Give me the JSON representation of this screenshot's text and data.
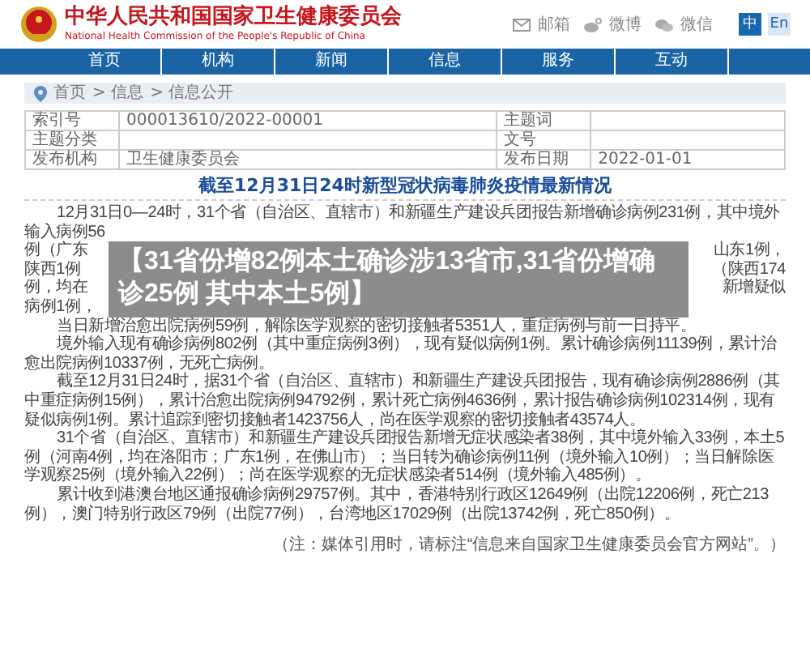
{
  "header": {
    "title": "中华人民共和国国家卫生健康委员会",
    "subtitle": "National Health Commission of the People's Republic of China",
    "links": [
      {
        "kind": "mail",
        "label": "邮箱"
      },
      {
        "kind": "weibo",
        "label": "微博"
      },
      {
        "kind": "wechat",
        "label": "微信"
      }
    ],
    "languages": [
      {
        "label": "中",
        "selected": true
      },
      {
        "label": "En",
        "selected": false
      }
    ]
  },
  "nav": [
    {
      "label": "首页"
    },
    {
      "label": "机构"
    },
    {
      "label": "新闻"
    },
    {
      "label": "信息"
    },
    {
      "label": "服务"
    },
    {
      "label": "互动"
    }
  ],
  "breadcrumb": [
    "首页",
    "> 信息",
    "> 信息公开"
  ],
  "meta_table": [
    [
      {
        "label": "索引号",
        "value": "000013610/2022-00001"
      },
      {
        "label": "主题词"
      }
    ],
    [
      {
        "label": "主题分类"
      },
      {
        "label": "文号"
      }
    ],
    [
      {
        "label": "发布机构",
        "value": "卫生健康委员会"
      },
      {
        "label": "发布日期",
        "value": "2022-01-01"
      }
    ]
  ],
  "article": {
    "title": "截至12月31日24时新型冠状病毒肺炎疫情最新情况",
    "first_line": "12月31日0—24时，31个省（自治区、直辖市）和新疆生产建设兵团报告新增确诊病例231例，其中境外输入病例56",
    "covered_lines": [
      {
        "left": "例（广东",
        "right": "山东1例，"
      },
      {
        "left": "陕西1例",
        "right": "（陕西174"
      },
      {
        "left": "例，均在",
        "right": "新增疑似"
      },
      {
        "left": "病例1例，"
      }
    ],
    "overlay_title": "【31省份增82例本土确诊涉13省市,31省份增确诊25例 其中本土5例】",
    "paragraphs": [
      "当日新增治愈出院病例59例，解除医学观察的密切接触者5351人，重症病例与前一日持平。",
      "境外输入现有确诊病例802例（其中重症病例3例），现有疑似病例1例。累计确诊病例11139例，累计治愈出院病例10337例，无死亡病例。",
      "截至12月31日24时，据31个省（自治区、直辖市）和新疆生产建设兵团报告，现有确诊病例2886例（其中重症病例15例），累计治愈出院病例94792例，累计死亡病例4636例，累计报告确诊病例102314例，现有疑似病例1例。累计追踪到密切接触者1423756人，尚在医学观察的密切接触者43574人。",
      "31个省（自治区、直辖市）和新疆生产建设兵团报告新增无症状感染者38例，其中境外输入33例，本土5例（河南4例，均在洛阳市；广东1例，在佛山市）；当日转为确诊病例11例（境外输入10例）；当日解除医学观察25例（境外输入22例）；尚在医学观察的无症状感染者514例（境外输入485例）。",
      "累计收到港澳台地区通报确诊病例29757例。其中，香港特别行政区12649例（出院12206例，死亡213例），澳门特别行政区79例（出院77例），台湾地区17029例（出院13742例，死亡850例）。"
    ],
    "note": "（注：媒体引用时，请标注“信息来自国家卫生健康委员会官方网站”。）"
  }
}
